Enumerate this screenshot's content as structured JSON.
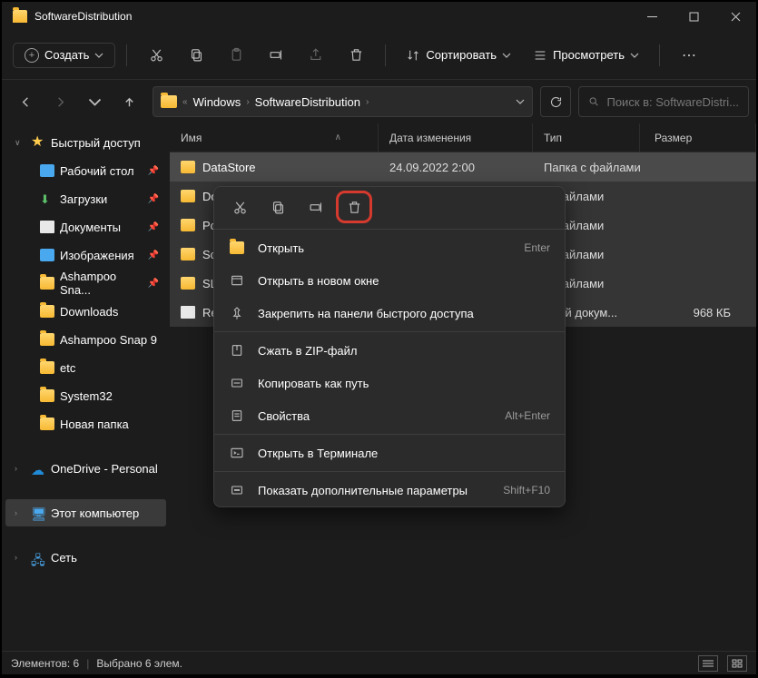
{
  "title": "SoftwareDistribution",
  "toolbar": {
    "new_label": "Создать",
    "sort_label": "Сортировать",
    "view_label": "Просмотреть"
  },
  "breadcrumb": {
    "seg1": "Windows",
    "seg2": "SoftwareDistribution"
  },
  "search": {
    "placeholder": "Поиск в: SoftwareDistri..."
  },
  "sidebar": {
    "quick": "Быстрый доступ",
    "desktop": "Рабочий стол",
    "downloads": "Загрузки",
    "documents": "Документы",
    "pictures": "Изображения",
    "ash_sna": "Ashampoo Sna...",
    "dl": "Downloads",
    "ash9": "Ashampoo Snap 9",
    "etc": "etc",
    "sys32": "System32",
    "newf": "Новая папка",
    "onedrive": "OneDrive - Personal",
    "thispc": "Этот компьютер",
    "network": "Сеть"
  },
  "columns": {
    "name": "Имя",
    "date": "Дата изменения",
    "type": "Тип",
    "size": "Размер"
  },
  "rows": [
    {
      "name": "DataStore",
      "date": "24.09.2022 2:00",
      "type": "Папка с файлами",
      "size": "",
      "kind": "folder"
    },
    {
      "name": "Do...",
      "date": "",
      "type": "с файлами",
      "size": "",
      "kind": "folder"
    },
    {
      "name": "Pos...",
      "date": "",
      "type": "с файлами",
      "size": "",
      "kind": "folder"
    },
    {
      "name": "Sca...",
      "date": "",
      "type": "с файлами",
      "size": "",
      "kind": "folder"
    },
    {
      "name": "SLS...",
      "date": "",
      "type": "с файлами",
      "size": "",
      "kind": "folder"
    },
    {
      "name": "Rep...",
      "date": "",
      "type": "овый докум...",
      "size": "968 КБ",
      "kind": "doc"
    }
  ],
  "ctx": {
    "open": "Открыть",
    "open_sc": "Enter",
    "new_window": "Открыть в новом окне",
    "pin_quick": "Закрепить на панели быстрого доступа",
    "zip": "Сжать в ZIP-файл",
    "copy_path": "Копировать как путь",
    "props": "Свойства",
    "props_sc": "Alt+Enter",
    "terminal": "Открыть в Терминале",
    "more": "Показать дополнительные параметры",
    "more_sc": "Shift+F10"
  },
  "status": {
    "count": "Элементов: 6",
    "selected": "Выбрано 6 элем."
  }
}
